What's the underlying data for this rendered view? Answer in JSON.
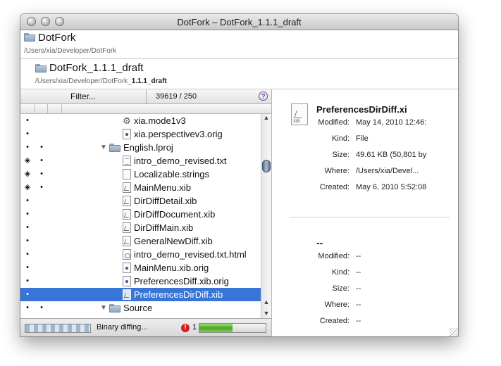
{
  "window": {
    "title": "DotFork – DotFork_1.1.1_draft"
  },
  "pathbar1": {
    "name": "DotFork",
    "path": "/Users/xia/Developer/DotFork"
  },
  "pathbar2": {
    "name": "DotFork_1.1.1_draft",
    "path_prefix": "/Users/xia/Developer/DotFork_",
    "path_bold": "1.1.1_draft"
  },
  "filter": {
    "label": "Filter...",
    "count": "39619 / 250",
    "help": "?"
  },
  "tree": {
    "rows": [
      {
        "label": "xia.mode1v3",
        "icon": "gear",
        "dots": [
          "•",
          ""
        ]
      },
      {
        "label": "xia.perspectivev3.orig",
        "icon": "orig",
        "dots": [
          "•",
          ""
        ]
      },
      {
        "label": "English.lproj",
        "icon": "folder",
        "dots": [
          "•",
          "•"
        ],
        "disclosure": "▼"
      },
      {
        "label": "intro_demo_revised.txt",
        "icon": "txt",
        "dots": [
          "◈",
          "•"
        ]
      },
      {
        "label": "Localizable.strings",
        "icon": "blank",
        "dots": [
          "◈",
          "•"
        ]
      },
      {
        "label": "MainMenu.xib",
        "icon": "xib",
        "dots": [
          "◈",
          "•"
        ]
      },
      {
        "label": "DirDiffDetail.xib",
        "icon": "xib",
        "dots": [
          "•",
          ""
        ]
      },
      {
        "label": "DirDiffDocument.xib",
        "icon": "xib",
        "dots": [
          "•",
          ""
        ]
      },
      {
        "label": "DirDiffMain.xib",
        "icon": "xib",
        "dots": [
          "•",
          ""
        ]
      },
      {
        "label": "GeneralNewDiff.xib",
        "icon": "xib",
        "dots": [
          "•",
          ""
        ]
      },
      {
        "label": "intro_demo_revised.txt.html",
        "icon": "html",
        "dots": [
          "•",
          ""
        ]
      },
      {
        "label": "MainMenu.xib.orig",
        "icon": "orig",
        "dots": [
          "•",
          ""
        ]
      },
      {
        "label": "PreferencesDiff.xib.orig",
        "icon": "orig",
        "dots": [
          "•",
          ""
        ]
      },
      {
        "label": "PreferencesDirDiff.xib",
        "icon": "xib",
        "dots": [
          "•",
          ""
        ],
        "selected": true
      },
      {
        "label": "Source",
        "icon": "folder",
        "dots": [
          "•",
          "•"
        ],
        "disclosure": "▼"
      }
    ]
  },
  "status": {
    "text": "Binary diffing...",
    "error_count": "1",
    "error_icon": "!",
    "progress": 0.5
  },
  "info": {
    "filename": "PreferencesDirDiff.xi",
    "icon_ext": "XIB",
    "rows": [
      {
        "key": "Modified:",
        "value": "May 14, 2010 12:46:"
      },
      {
        "key": "Kind:",
        "value": "File"
      },
      {
        "key": "Size:",
        "value": "49.61 KB (50,801 by"
      },
      {
        "key": "Where:",
        "value": "/Users/xia/Devel..."
      },
      {
        "key": "Created:",
        "value": "May 6, 2010 5:52:08"
      }
    ],
    "compare_name": "--",
    "compare_rows": [
      {
        "key": "Modified:",
        "value": "--"
      },
      {
        "key": "Kind:",
        "value": "--"
      },
      {
        "key": "Size:",
        "value": "--"
      },
      {
        "key": "Where:",
        "value": "--"
      },
      {
        "key": "Created:",
        "value": "--"
      }
    ]
  }
}
